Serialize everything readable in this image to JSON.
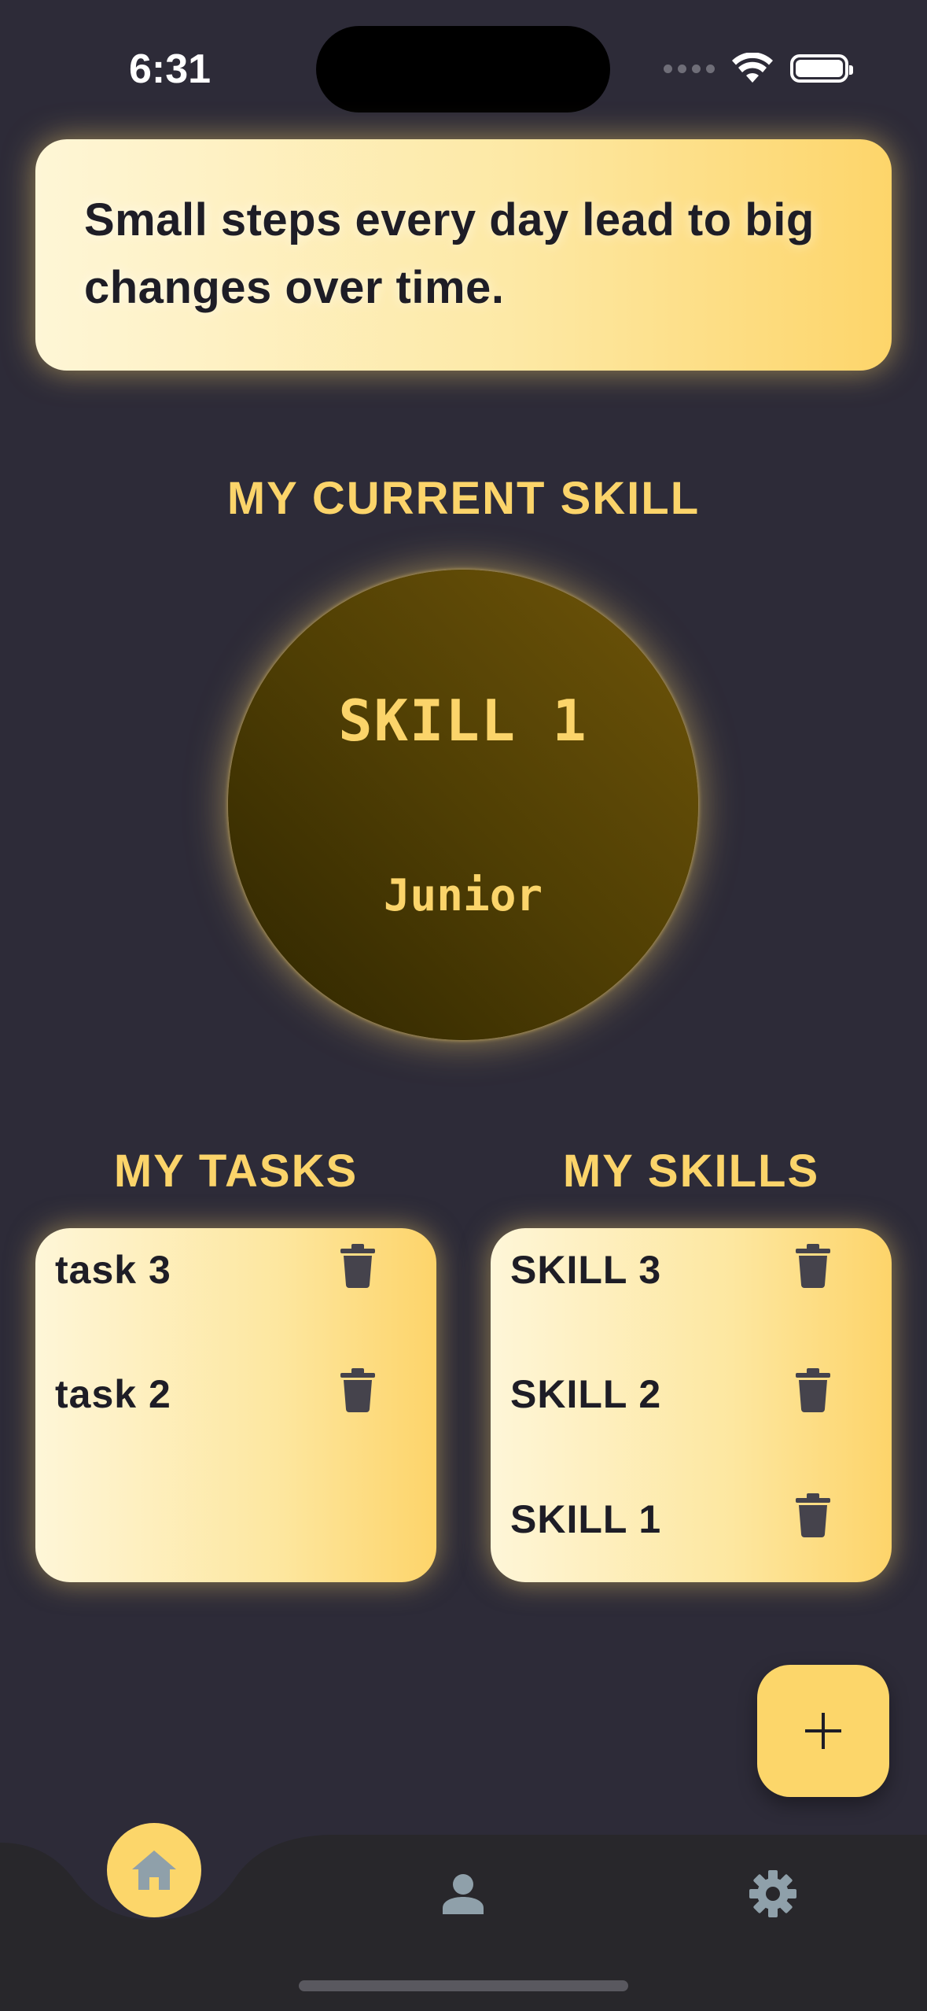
{
  "status_bar": {
    "time": "6:31"
  },
  "quote": {
    "text": "Small steps every day lead to big changes over time."
  },
  "current_skill": {
    "title": "MY CURRENT SKILL",
    "name": "SKILL 1",
    "level": "Junior"
  },
  "tasks": {
    "title": "MY TASKS",
    "items": [
      {
        "label": "task 3"
      },
      {
        "label": "task 2"
      }
    ]
  },
  "skills": {
    "title": "MY SKILLS",
    "items": [
      {
        "label": "SKILL 3"
      },
      {
        "label": "SKILL 2"
      },
      {
        "label": "SKILL 1"
      }
    ]
  },
  "fab": {
    "icon": "plus-icon",
    "label": "+"
  },
  "bottom_nav": {
    "items": [
      {
        "icon": "home-icon",
        "active": true
      },
      {
        "icon": "person-icon",
        "active": false
      },
      {
        "icon": "gear-icon",
        "active": false
      }
    ]
  },
  "colors": {
    "background": "#2d2b38",
    "accent": "#fcd66a",
    "nav_background": "#28272b",
    "icon_inactive": "#8fa0aa",
    "trash_icon": "#45434c",
    "text_dark": "#1e1d26"
  }
}
